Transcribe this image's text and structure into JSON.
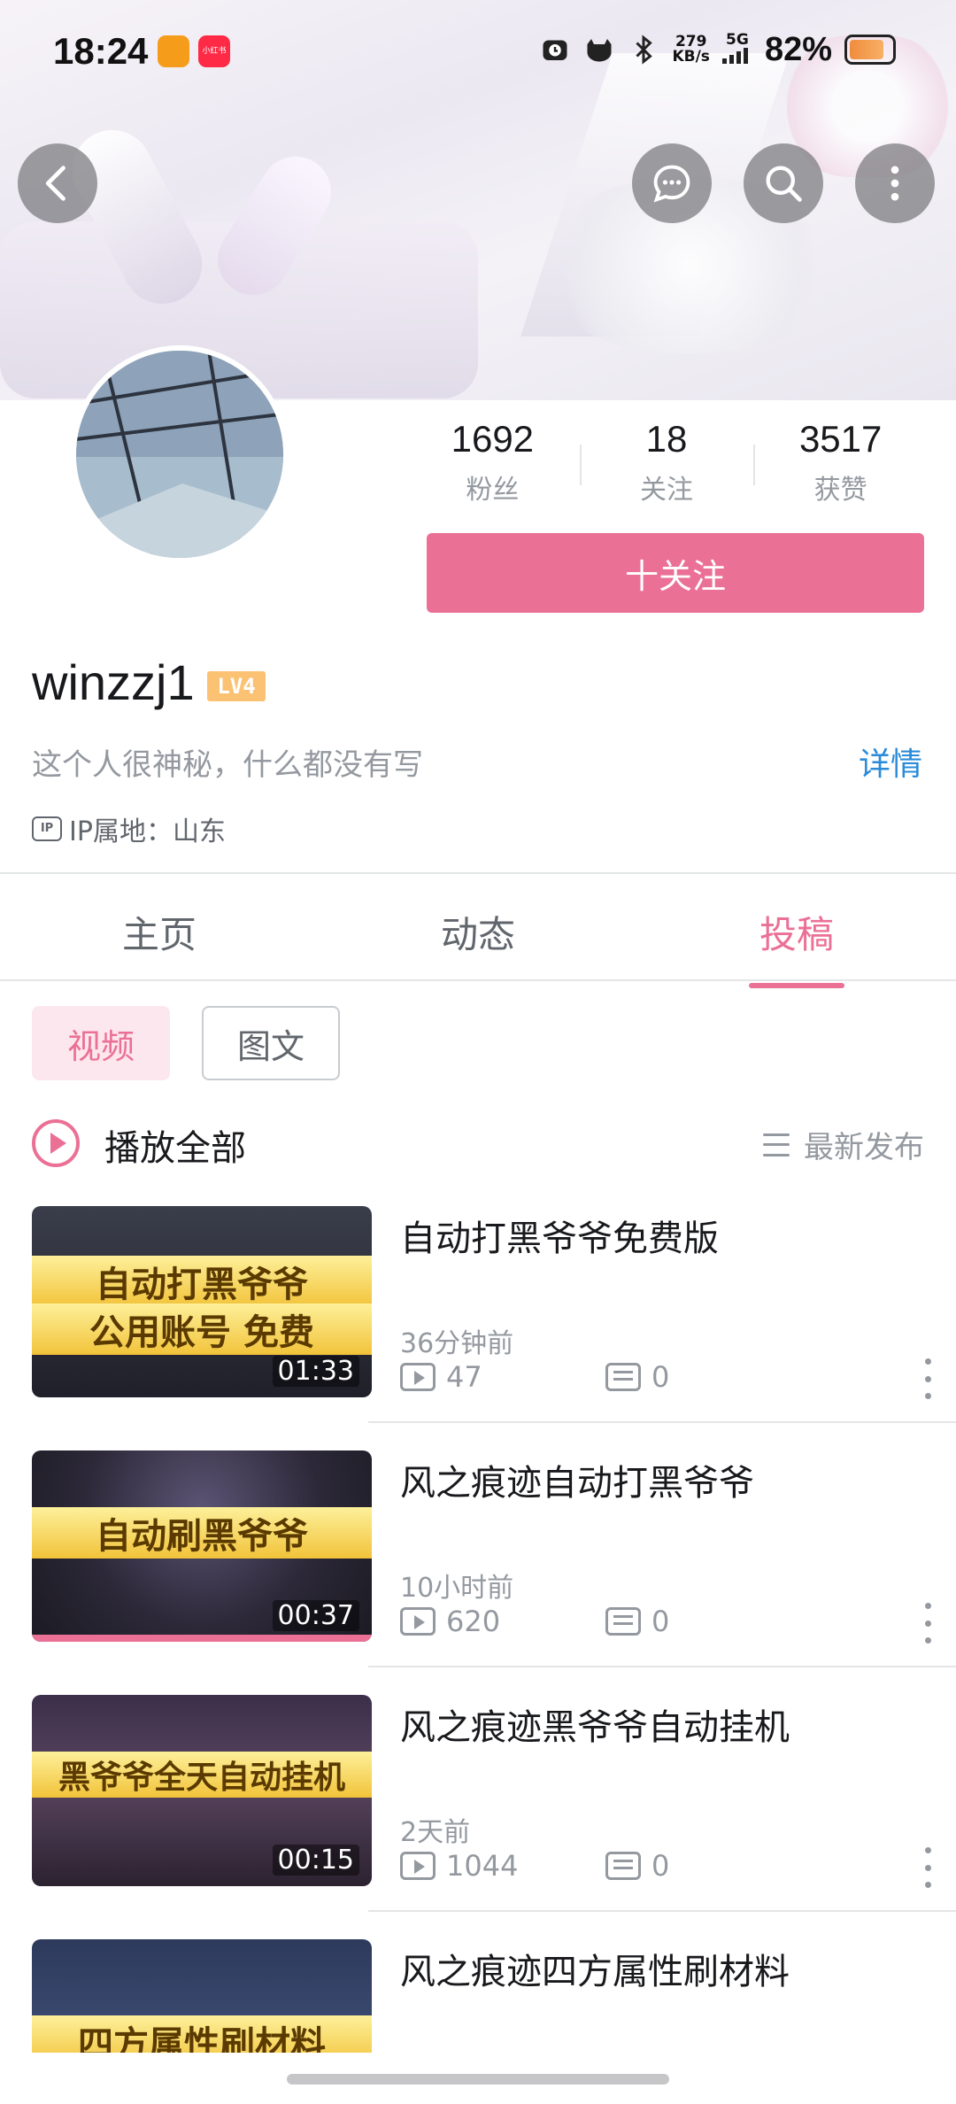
{
  "status_bar": {
    "time": "18:24",
    "app_badge_red_label": "小红书",
    "net_speed_value": "279",
    "net_speed_unit": "KB/s",
    "network": "5G",
    "battery_percent": "82%",
    "battery_level": 0.82
  },
  "nav": {
    "back_icon": "back-arrow-icon",
    "message_icon": "chat-bubble-icon",
    "search_icon": "search-icon",
    "more_icon": "more-vertical-icon"
  },
  "profile": {
    "stats": [
      {
        "value": "1692",
        "label": "粉丝"
      },
      {
        "value": "18",
        "label": "关注"
      },
      {
        "value": "3517",
        "label": "获赞"
      }
    ],
    "follow_label": "十关注",
    "username": "winzzj1",
    "level": "LV4",
    "bio": "这个人很神秘，什么都没有写",
    "detail_link": "详情",
    "ip_icon_text": "IP",
    "ip_location": "IP属地：山东"
  },
  "tabs": [
    {
      "label": "主页",
      "active": false
    },
    {
      "label": "动态",
      "active": false
    },
    {
      "label": "投稿",
      "active": true
    }
  ],
  "filters": {
    "video": "视频",
    "article": "图文"
  },
  "list_header": {
    "play_all": "播放全部",
    "sort": "最新发布"
  },
  "videos": [
    {
      "title": "自动打黑爷爷免费版",
      "time_ago": "36分钟前",
      "views": "47",
      "comments": "0",
      "duration": "01:33",
      "thumb_line1": "自动打黑爷爷",
      "thumb_line2": "公用账号 免费",
      "watched_fraction": 0
    },
    {
      "title": "风之痕迹自动打黑爷爷",
      "time_ago": "10小时前",
      "views": "620",
      "comments": "0",
      "duration": "00:37",
      "thumb_line1": "自动刷黑爷爷",
      "thumb_line2": "",
      "watched_fraction": 1
    },
    {
      "title": "风之痕迹黑爷爷自动挂机",
      "time_ago": "2天前",
      "views": "1044",
      "comments": "0",
      "duration": "00:15",
      "thumb_line1": "黑爷爷全天自动挂机",
      "thumb_line2": "",
      "watched_fraction": 0
    },
    {
      "title": "风之痕迹四方属性刷材料",
      "time_ago": "",
      "views": "",
      "comments": "",
      "duration": "",
      "thumb_line1": "四方属性刷材料",
      "thumb_line2": "",
      "watched_fraction": 0
    }
  ],
  "colors": {
    "accent": "#eb7096",
    "link": "#2b8bd8",
    "muted_text": "#9499a0",
    "level_badge": "#fbc274"
  }
}
